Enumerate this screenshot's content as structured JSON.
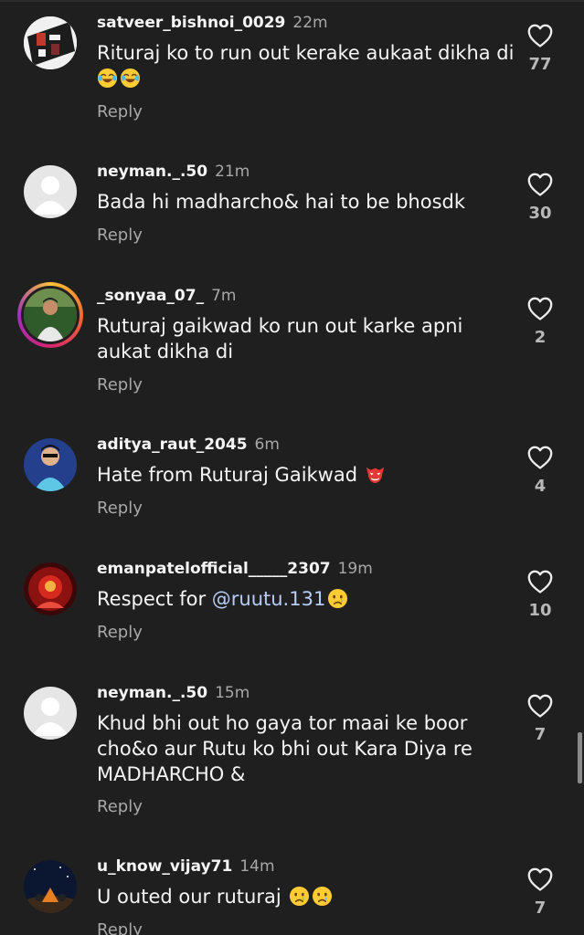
{
  "reply_label": "Reply",
  "comments": [
    {
      "username": "satveer_bishnoi_0029",
      "time": "22m",
      "lines": [
        "Rituraj ko to run out kerake aukaat dikha di"
      ],
      "likes": "77"
    },
    {
      "username": "neyman._.50",
      "time": "21m",
      "lines": [
        "Bada hi madharcho& hai to be bhosdk"
      ],
      "likes": "30"
    },
    {
      "username": "_sonyaa_07_",
      "time": "7m",
      "lines": [
        "Ruturaj gaikwad ko run out karke apni",
        "aukat dikha di"
      ],
      "likes": "2"
    },
    {
      "username": "aditya_raut_2045",
      "time": "6m",
      "lines": [
        "Hate from Ruturaj Gaikwad"
      ],
      "likes": "4"
    },
    {
      "username": "emanpatelofficial_____2307",
      "time": "19m",
      "lines": [
        "Respect for "
      ],
      "mention": "@ruutu.131",
      "likes": "10"
    },
    {
      "username": "neyman._.50",
      "time": "15m",
      "lines": [
        "Khud bhi out ho gaya tor maai ke boor",
        "cho&o aur Rutu ko bhi out Kara Diya re",
        "MADHARCHO &"
      ],
      "likes": "7"
    },
    {
      "username": "u_know_vijay71",
      "time": "14m",
      "lines": [
        "U outed our ruturaj"
      ],
      "likes": "7"
    }
  ],
  "icons": {
    "like": "heart-outline-icon",
    "joy": "face-with-tears-of-joy-emoji",
    "goblin": "goblin-mask-emoji",
    "crying": "crying-face-emoji"
  },
  "colors": {
    "background": "#1f1f1f",
    "text": "#f5f5f5",
    "secondary": "#a8a8a8",
    "mention": "#b6cdf6"
  }
}
